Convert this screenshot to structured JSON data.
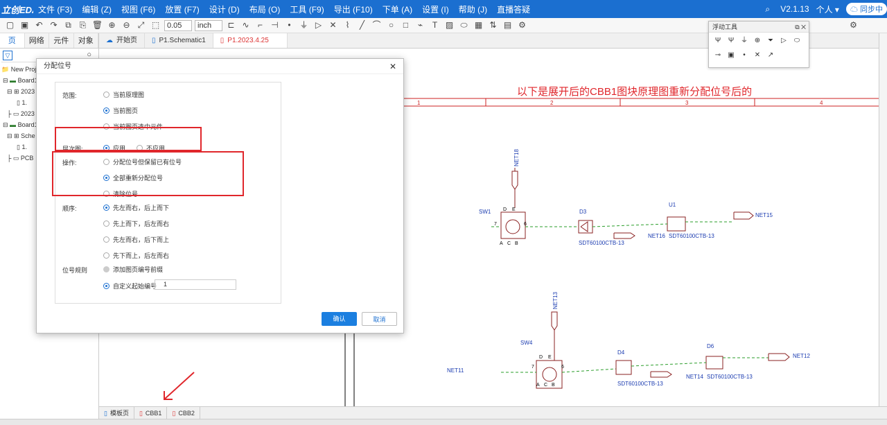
{
  "menu": {
    "logo": "立创EDA",
    "items": [
      "文件 (F3)",
      "编辑 (Z)",
      "视图 (F6)",
      "放置 (F7)",
      "设计 (D)",
      "布局 (O)",
      "工具 (F9)",
      "导出 (F10)",
      "下单 (A)",
      "设置 (I)",
      "帮助 (J)",
      "直播答疑"
    ],
    "version": "V2.1.13",
    "user": "个人",
    "sync": "同步中"
  },
  "toolbar": {
    "grid_value": "0.05",
    "unit_value": "inch"
  },
  "left_panel": {
    "tabs": [
      "页",
      "网络",
      "元件",
      "对象"
    ],
    "tree": [
      "New Project",
      "Board1_",
      "2023",
      "1.",
      "2023",
      "Board1",
      "Sche",
      "1.",
      "PCB"
    ]
  },
  "doc_tabs": [
    "开始页",
    "P1.Schematic1",
    "P1.2023.4.25"
  ],
  "floating_panel": {
    "title": "浮动工具"
  },
  "dialog": {
    "title": "分配位号",
    "scope_label": "范围:",
    "scope_options": [
      "当前原理图",
      "当前图页",
      "当前图页选中元件"
    ],
    "hierarchy_label": "层次图:",
    "hierarchy_options": [
      "应用",
      "不应用"
    ],
    "operation_label": "操作:",
    "operation_options": [
      "分配位号但保留已有位号",
      "全部重新分配位号",
      "清除位号"
    ],
    "order_label": "顺序:",
    "order_options": [
      "先左而右，后上而下",
      "先上而下，后左而右",
      "先左而右，后下而上",
      "先下而上，后左而右"
    ],
    "rule_label": "位号规则",
    "rule_options": [
      "添加图页编号前缀",
      "自定义起始编号"
    ],
    "start_number": "1",
    "confirm": "确认",
    "cancel": "取消"
  },
  "canvas": {
    "annotation": "以下是展开后的CBB1图块原理图重新分配位号后的",
    "columns": [
      "1",
      "2",
      "3",
      "4"
    ],
    "circuit_top": {
      "switch_ref": "SW1",
      "net_up": "NET18",
      "diode1_ref": "D3",
      "diode1_value": "SDT60100CTB-13",
      "diode2_ref": "U1",
      "diode2_value": "SDT60100CTB-13",
      "net_right": "NET15",
      "net_mid": "NET16",
      "pins_top": [
        "D",
        "E"
      ],
      "pins_bottom": [
        "A",
        "C",
        "B"
      ],
      "pin_left": "7",
      "pin_right": "6"
    },
    "circuit_bottom": {
      "switch_ref": "SW4",
      "net_up": "NET13",
      "net_left": "NET11",
      "diode1_ref": "D4",
      "diode1_value": "SDT60100CTB-13",
      "diode2_ref": "D6",
      "diode2_value": "SDT60100CTB-13",
      "net_right": "NET12",
      "net_mid": "NET14",
      "pins_top": [
        "D",
        "E"
      ],
      "pins_bottom": [
        "A",
        "C",
        "B"
      ],
      "pin_left": "7",
      "pin_right": "6"
    }
  },
  "sheet_tabs": [
    "模板页",
    "CBB1",
    "CBB2"
  ],
  "colors": {
    "accent": "#1b6fd0",
    "highlight": "#e0262b",
    "net": "#1a3bb0",
    "wire": "#2a9d2a"
  }
}
